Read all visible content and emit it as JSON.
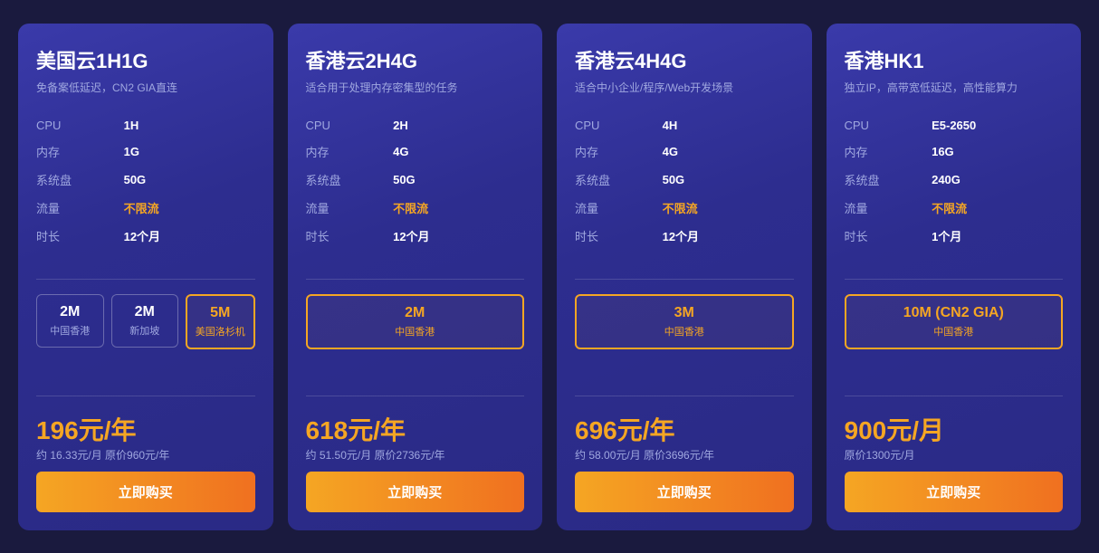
{
  "cards": [
    {
      "id": "us-1h1g",
      "title": "美国云1H1G",
      "subtitle": "免备案低延迟，CN2 GIA直连",
      "specs": [
        {
          "label": "CPU",
          "value": "1H"
        },
        {
          "label": "内存",
          "value": "1G"
        },
        {
          "label": "系统盘",
          "value": "50G"
        },
        {
          "label": "流量",
          "value": "不限流",
          "highlight": true
        },
        {
          "label": "时长",
          "value": "12个月"
        }
      ],
      "bandwidth": [
        {
          "value": "2M",
          "location": "中国香港",
          "selected": false
        },
        {
          "value": "2M",
          "location": "新加坡",
          "selected": false
        },
        {
          "value": "5M",
          "location": "美国洛杉机",
          "selected": true
        }
      ],
      "price_main": "196元/年",
      "price_sub": "约 16.33元/月  原价960元/年",
      "buy_label": "立即购买"
    },
    {
      "id": "hk-2h4g",
      "title": "香港云2H4G",
      "subtitle": "适合用于处理内存密集型的任务",
      "specs": [
        {
          "label": "CPU",
          "value": "2H"
        },
        {
          "label": "内存",
          "value": "4G"
        },
        {
          "label": "系统盘",
          "value": "50G"
        },
        {
          "label": "流量",
          "value": "不限流",
          "highlight": true
        },
        {
          "label": "时长",
          "value": "12个月"
        }
      ],
      "bandwidth": [
        {
          "value": "2M",
          "location": "中国香港",
          "selected": true
        }
      ],
      "price_main": "618元/年",
      "price_sub": "约 51.50元/月  原价2736元/年",
      "buy_label": "立即购买"
    },
    {
      "id": "hk-4h4g",
      "title": "香港云4H4G",
      "subtitle": "适合中小企业/程序/Web开发场景",
      "specs": [
        {
          "label": "CPU",
          "value": "4H"
        },
        {
          "label": "内存",
          "value": "4G"
        },
        {
          "label": "系统盘",
          "value": "50G"
        },
        {
          "label": "流量",
          "value": "不限流",
          "highlight": true
        },
        {
          "label": "时长",
          "value": "12个月"
        }
      ],
      "bandwidth": [
        {
          "value": "3M",
          "location": "中国香港",
          "selected": true
        }
      ],
      "price_main": "696元/年",
      "price_sub": "约 58.00元/月  原价3696元/年",
      "buy_label": "立即购买"
    },
    {
      "id": "hk-hk1",
      "title": "香港HK1",
      "subtitle": "独立IP，高带宽低延迟，高性能算力",
      "specs": [
        {
          "label": "CPU",
          "value": "E5-2650"
        },
        {
          "label": "内存",
          "value": "16G"
        },
        {
          "label": "系统盘",
          "value": "240G"
        },
        {
          "label": "流量",
          "value": "不限流",
          "highlight": true
        },
        {
          "label": "时长",
          "value": "1个月"
        }
      ],
      "bandwidth": [
        {
          "value": "10M (CN2 GIA)",
          "location": "中国香港",
          "selected": true
        }
      ],
      "price_main": "900元/月",
      "price_sub": "原价1300元/月",
      "buy_label": "立即购买"
    }
  ]
}
